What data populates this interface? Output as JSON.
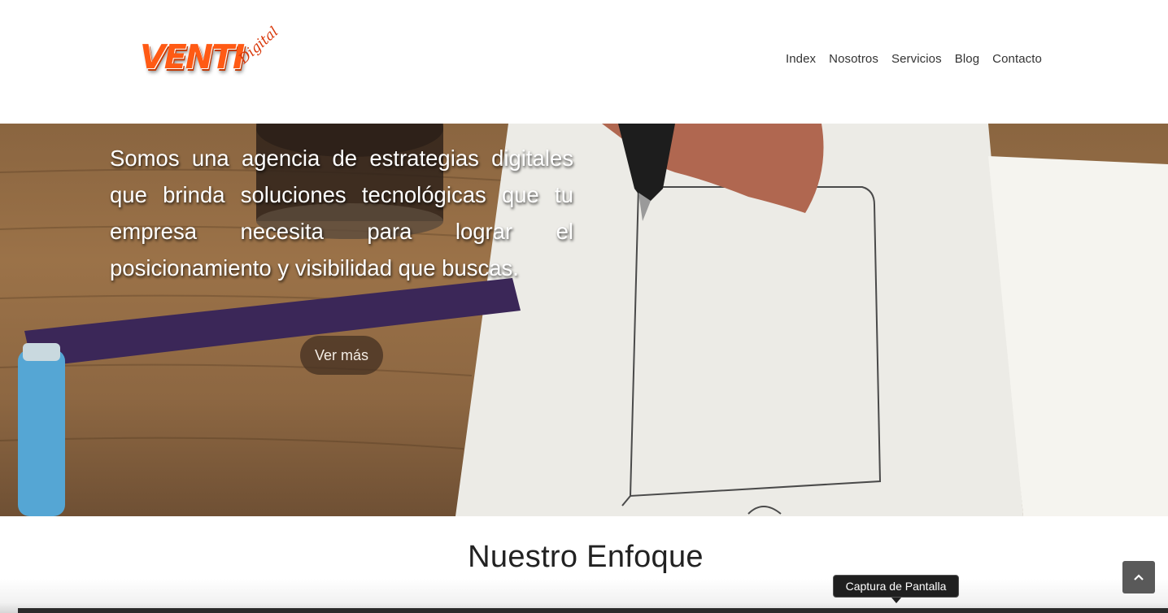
{
  "brand": {
    "name": "VENTI",
    "tagline": "Digital"
  },
  "nav": {
    "items": [
      {
        "label": "Index"
      },
      {
        "label": "Nosotros"
      },
      {
        "label": "Servicios"
      },
      {
        "label": "Blog"
      },
      {
        "label": "Contacto"
      }
    ]
  },
  "hero": {
    "text": "Somos una agencia de estrategias digitales que brinda soluciones tecnológicas que tu empresa necesita para lograr el posicionamiento y visibilidad que buscas.",
    "button_label": "Ver más"
  },
  "section": {
    "title": "Nuestro Enfoque"
  },
  "tooltip": {
    "text": "Captura de Pantalla"
  },
  "scroll_top": {
    "icon": "chevron-up-icon"
  },
  "colors": {
    "brand_orange": "#ff5a14",
    "text_dark": "#222222"
  }
}
